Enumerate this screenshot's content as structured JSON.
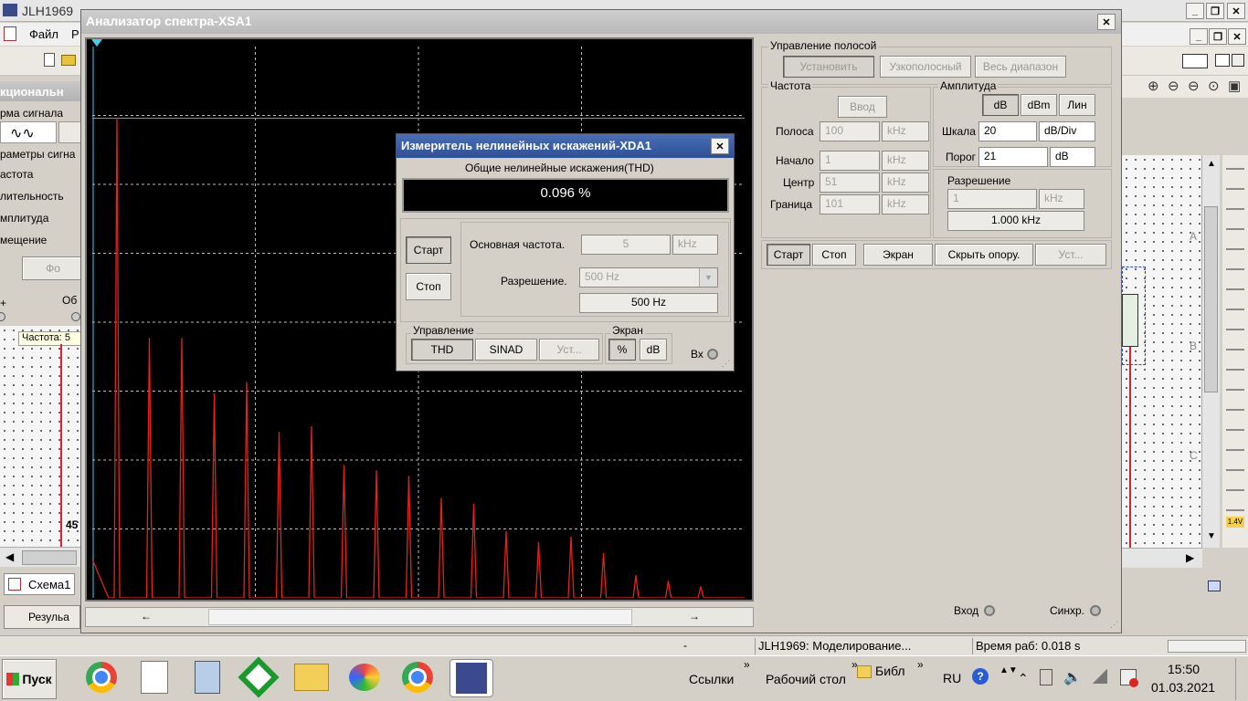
{
  "main_app": {
    "title": "JLH1969",
    "menu_file": "Файл",
    "menu_partial": "Р",
    "panel_title": "кциональн",
    "panel_labels": [
      "рма сигнала",
      "раметры сигна",
      "астота",
      "лительность",
      "мплитуда",
      "мещение"
    ],
    "fo_button": "Фо",
    "plus": "+",
    "obsh": "Об",
    "freq_tooltip": "Частота: 5",
    "value_45": "45",
    "schema_tab": "Схема1",
    "result_tab": "Резульа",
    "right_letters": [
      "A",
      "B",
      "C"
    ],
    "volt_badge": "1.4V"
  },
  "spectrum_analyzer": {
    "title": "Анализатор спектра-XSA1",
    "band_control": {
      "title": "Управление полосой",
      "set_button": "Установить",
      "narrow_button": "Узкополосный",
      "full_button": "Весь диапазон"
    },
    "frequency": {
      "title": "Частота",
      "enter_button": "Ввод",
      "rows": [
        {
          "label": "Полоса",
          "value": "100",
          "unit": "kHz"
        },
        {
          "label": "Начало",
          "value": "1",
          "unit": "kHz"
        },
        {
          "label": "Центр",
          "value": "51",
          "unit": "kHz"
        },
        {
          "label": "Граница",
          "value": "101",
          "unit": "kHz"
        }
      ]
    },
    "amplitude": {
      "title": "Амплитуда",
      "db_button": "dB",
      "dbm_button": "dBm",
      "lin_button": "Лин",
      "scale_label": "Шкала",
      "scale_value": "20",
      "scale_unit": "dB/Div",
      "threshold_label": "Порог",
      "threshold_value": "21",
      "threshold_unit": "dB"
    },
    "resolution": {
      "title": "Разрешение",
      "value": "1",
      "unit": "kHz",
      "display": "1.000 kHz"
    },
    "bottom_buttons": {
      "start": "Старт",
      "stop": "Стоп",
      "screen": "Экран",
      "hide_ref": "Скрыть опору.",
      "settings": "Уст..."
    },
    "input_label": "Вход",
    "sync_label": "Синхр.",
    "scroll_left": "←",
    "scroll_right": "→"
  },
  "chart_data": {
    "type": "line",
    "title": "",
    "xlabel": "",
    "ylabel": "",
    "grid": true,
    "x_range_khz": [
      1,
      101
    ],
    "peaks_khz": [
      5,
      15,
      25,
      35,
      45,
      55,
      65,
      75,
      85,
      95
    ],
    "peak_heights_fraction": [
      0.87,
      0.47,
      0.47,
      0.37,
      0.39,
      0.3,
      0.31,
      0.24,
      0.23,
      0.22,
      0.18,
      0.17,
      0.12,
      0.1,
      0.11,
      0.08,
      0.04,
      0.03,
      0.02
    ],
    "threshold_line_fraction": 0.87,
    "colors": {
      "background": "#000000",
      "trace": "#e8201c",
      "grid": "#bdbdbd",
      "threshold": "#6fa86a"
    }
  },
  "distortion_meter": {
    "title": "Измеритель нелинейных искажений-XDA1",
    "thd_caption": "Общие нелинейные искажения(THD)",
    "thd_value": "0.096 %",
    "start_button": "Старт",
    "stop_button": "Стоп",
    "fund_freq_label": "Основная частота.",
    "fund_freq_value": "5",
    "fund_freq_unit": "kHz",
    "resolution_label": "Разрешение.",
    "resolution_select": "500 Hz",
    "resolution_display": "500 Hz",
    "control_title": "Управление",
    "thd_button": "THD",
    "sinad_button": "SINAD",
    "settings_button": "Уст...",
    "screen_title": "Экран",
    "percent_button": "%",
    "db_button": "dB",
    "input_label": "Вх"
  },
  "status_bar": {
    "dash": "-",
    "modeling": "JLH1969: Моделирование...",
    "work_time": "Время раб: 0.018 s"
  },
  "taskbar": {
    "start": "Пуск",
    "links": "Ссылки",
    "desktop": "Рабочий стол",
    "library": "Библ",
    "lang": "RU",
    "time": "15:50",
    "date": "01.03.2021"
  }
}
